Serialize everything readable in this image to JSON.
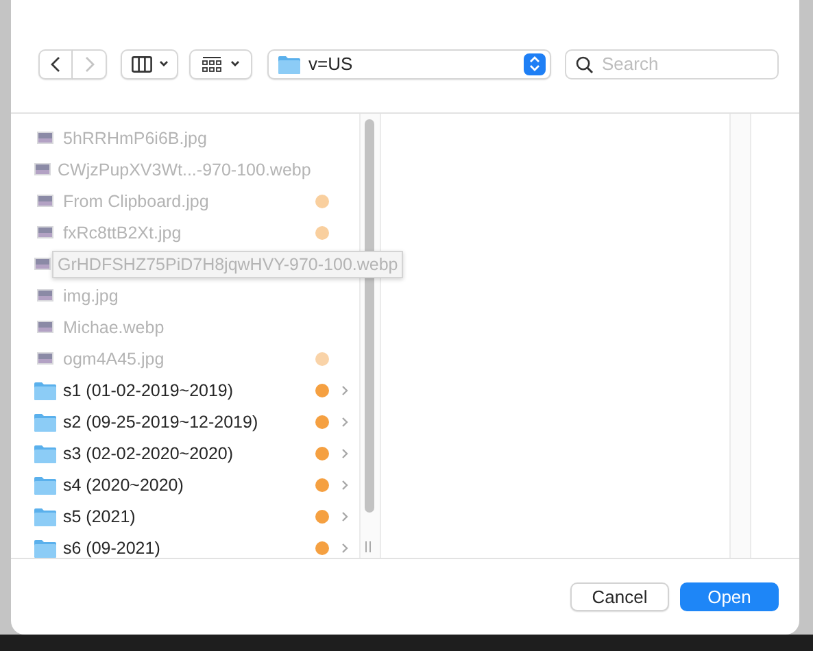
{
  "toolbar": {
    "back": {
      "disabled": false
    },
    "forward": {
      "disabled": true
    },
    "location": "v=US",
    "search": {
      "placeholder": "Search"
    }
  },
  "items": [
    {
      "kind": "file",
      "name": "5hRRHmP6i6B.jpg",
      "disabled": true
    },
    {
      "kind": "file",
      "name": "CWjzPupXV3Wt...-970-100.webp",
      "disabled": true
    },
    {
      "kind": "file",
      "name": "From Clipboard.jpg",
      "disabled": true,
      "color": "#f9cf9e"
    },
    {
      "kind": "file",
      "name": "fxRc8ttB2Xt.jpg",
      "disabled": true,
      "color": "#f9cf9e"
    },
    {
      "kind": "file",
      "name": "GrHDFSHZ75PiD7H8jqwHVY-970-100.webp",
      "disabled": true,
      "hovered": true
    },
    {
      "kind": "file",
      "name": "img.jpg",
      "disabled": true
    },
    {
      "kind": "file",
      "name": "Michae.webp",
      "disabled": true
    },
    {
      "kind": "file",
      "name": "ogm4A45.jpg",
      "disabled": true,
      "color": "#f9d3a8"
    },
    {
      "kind": "folder",
      "name": "s1 (01-02-2019~2019)",
      "disabled": false,
      "color": "#f5a041"
    },
    {
      "kind": "folder",
      "name": "s2 (09-25-2019~12-2019)",
      "disabled": false,
      "color": "#f5a041"
    },
    {
      "kind": "folder",
      "name": "s3 (02-02-2020~2020)",
      "disabled": false,
      "color": "#f5a041"
    },
    {
      "kind": "folder",
      "name": "s4 (2020~2020)",
      "disabled": false,
      "color": "#f5a041"
    },
    {
      "kind": "folder",
      "name": "s5 (2021)",
      "disabled": false,
      "color": "#f5a041"
    },
    {
      "kind": "folder",
      "name": "s6 (09-2021)",
      "disabled": false,
      "color": "#f5a041"
    }
  ],
  "buttons": [
    {
      "kind": "cancel",
      "label": "Cancel"
    },
    {
      "kind": "default",
      "label": "Open"
    }
  ]
}
